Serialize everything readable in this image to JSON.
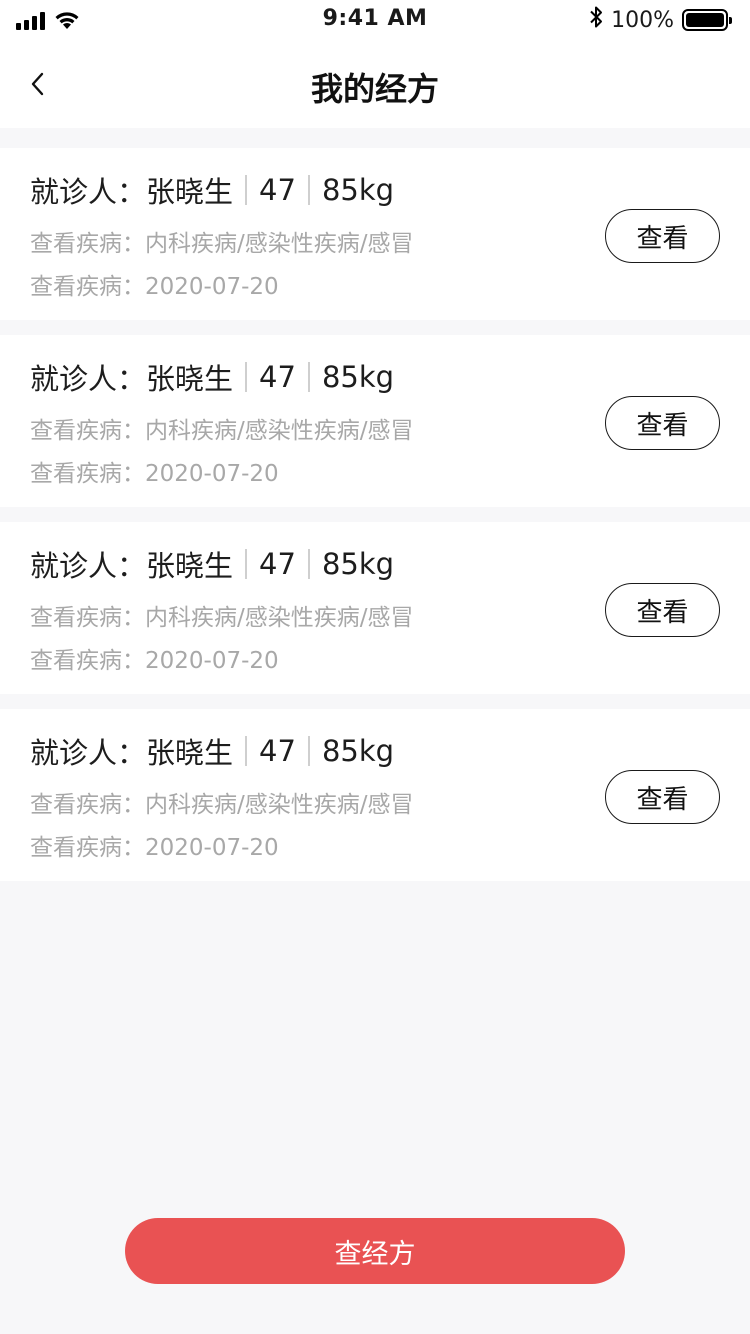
{
  "status_bar": {
    "time": "9:41 AM",
    "battery_text": "100%",
    "icons": [
      "signal-icon",
      "wifi-icon",
      "bluetooth-icon",
      "battery-icon"
    ]
  },
  "nav": {
    "title": "我的经方",
    "back_icon": "chevron-left-icon"
  },
  "cards": [
    {
      "patient_label": "就诊人：",
      "name": "张晓生",
      "age": "47",
      "weight": "85kg",
      "disease_label": "查看疾病：",
      "disease": "内科疾病/感染性疾病/感冒",
      "date_label": "查看疾病：",
      "date": "2020-07-20",
      "button_label": "查看"
    },
    {
      "patient_label": "就诊人：",
      "name": "张晓生",
      "age": "47",
      "weight": "85kg",
      "disease_label": "查看疾病：",
      "disease": "内科疾病/感染性疾病/感冒",
      "date_label": "查看疾病：",
      "date": "2020-07-20",
      "button_label": "查看"
    },
    {
      "patient_label": "就诊人：",
      "name": "张晓生",
      "age": "47",
      "weight": "85kg",
      "disease_label": "查看疾病：",
      "disease": "内科疾病/感染性疾病/感冒",
      "date_label": "查看疾病：",
      "date": "2020-07-20",
      "button_label": "查看"
    },
    {
      "patient_label": "就诊人：",
      "name": "张晓生",
      "age": "47",
      "weight": "85kg",
      "disease_label": "查看疾病：",
      "disease": "内科疾病/感染性疾病/感冒",
      "date_label": "查看疾病：",
      "date": "2020-07-20",
      "button_label": "查看"
    }
  ],
  "footer": {
    "primary_button": "查经方"
  },
  "colors": {
    "accent": "#e95253",
    "background": "#f7f7f9",
    "secondary_text": "#a8a8a8"
  }
}
